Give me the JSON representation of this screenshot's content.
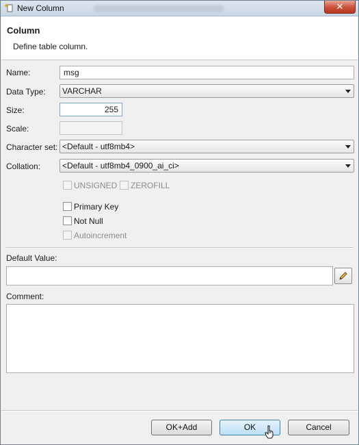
{
  "window": {
    "title": "New Column",
    "close_label": "✕"
  },
  "header": {
    "title": "Column",
    "description": "Define table column."
  },
  "form": {
    "name": {
      "label": "Name:",
      "value": "msg"
    },
    "data_type": {
      "label": "Data Type:",
      "value": "VARCHAR"
    },
    "size": {
      "label": "Size:",
      "value": "255"
    },
    "scale": {
      "label": "Scale:",
      "value": ""
    },
    "charset": {
      "label": "Character set:",
      "value": "<Default - utf8mb4>"
    },
    "collation": {
      "label": "Collation:",
      "value": "<Default - utf8mb4_0900_ai_ci>"
    },
    "unsigned": {
      "label": "UNSIGNED",
      "checked": false,
      "enabled": false
    },
    "zerofill": {
      "label": "ZEROFILL",
      "checked": false,
      "enabled": false
    },
    "primary_key": {
      "label": "Primary Key",
      "checked": false,
      "enabled": true
    },
    "not_null": {
      "label": "Not Null",
      "checked": false,
      "enabled": true
    },
    "autoincrement": {
      "label": "Autoincrement",
      "checked": false,
      "enabled": false
    },
    "default_value": {
      "label": "Default Value:",
      "value": ""
    },
    "comment": {
      "label": "Comment:",
      "value": ""
    }
  },
  "buttons": {
    "ok_add": "OK+Add",
    "ok": "OK",
    "cancel": "Cancel"
  },
  "icons": {
    "window_icon": "new-column-sparkle-icon",
    "edit_icon": "pencil-icon",
    "cursor": "mouse-pointer-icon"
  }
}
